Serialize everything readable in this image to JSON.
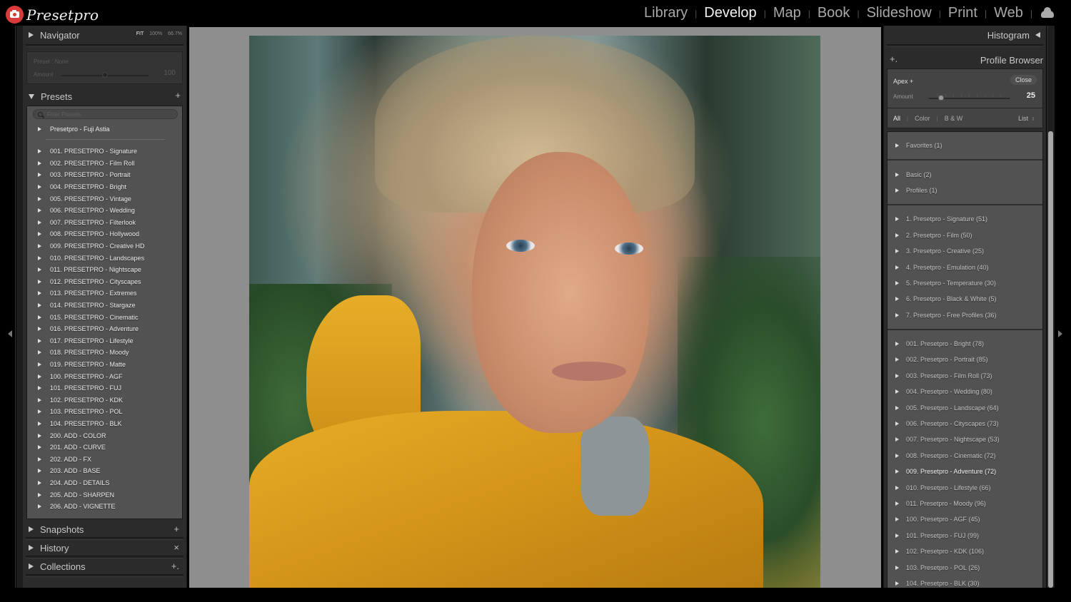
{
  "app": {
    "logo_text": "Presetpro",
    "modules": [
      {
        "label": "Library",
        "active": false
      },
      {
        "label": "Develop",
        "active": true
      },
      {
        "label": "Map",
        "active": false
      },
      {
        "label": "Book",
        "active": false
      },
      {
        "label": "Slideshow",
        "active": false
      },
      {
        "label": "Print",
        "active": false
      },
      {
        "label": "Web",
        "active": false
      }
    ],
    "cloud_icon": "cloud-icon"
  },
  "left_panel": {
    "navigator": {
      "title": "Navigator",
      "zoom_options": [
        "FIT",
        "100%",
        "66.7%"
      ]
    },
    "preset_amount": {
      "preset_label": "Preset : None",
      "amount_label": "Amount",
      "amount_value": "100",
      "slider_fraction": 0.5
    },
    "presets": {
      "title": "Presets",
      "add_icon": "+",
      "filter_placeholder": "Filter Presets",
      "top_item": "Presetpro - Fuji Astia",
      "items": [
        "001. PRESETPRO - Signature",
        "002. PRESETPRO - Film Roll",
        "003. PRESETPRO - Portrait",
        "004. PRESETPRO - Bright",
        "005. PRESETPRO - Vintage",
        "006. PRESETPRO - Wedding",
        "007. PRESETPRO - Filterlook",
        "008. PRESETPRO - Hollywood",
        "009. PRESETPRO - Creative HD",
        "010. PRESETPRO - Landscapes",
        "011. PRESETPRO - Nightscape",
        "012. PRESETPRO - Cityscapes",
        "013. PRESETPRO - Extremes",
        "014. PRESETPRO - Stargaze",
        "015. PRESETPRO - Cinematic",
        "016. PRESETPRO - Adventure",
        "017. PRESETPRO - Lifestyle",
        "018. PRESETPRO - Moody",
        "019. PRESETPRO - Matte",
        "100. PRESETPRO - AGF",
        "101. PRESETPRO - FUJ",
        "102. PRESETPRO - KDK",
        "103. PRESETPRO - POL",
        "104. PRESETPRO - BLK",
        "200. ADD - COLOR",
        "201. ADD - CURVE",
        "202. ADD - FX",
        "203. ADD - BASE",
        "204. ADD - DETAILS",
        "205. ADD - SHARPEN",
        "206. ADD - VIGNETTE"
      ]
    },
    "snapshots": {
      "title": "Snapshots",
      "action": "+"
    },
    "history": {
      "title": "History",
      "action": "×"
    },
    "collections": {
      "title": "Collections",
      "action": "+."
    }
  },
  "right_panel": {
    "histogram": {
      "title": "Histogram"
    },
    "profile_browser": {
      "title": "Profile Browser",
      "add_icon": "+.",
      "profile_name": "Apex +",
      "close_label": "Close",
      "amount_label": "Amount",
      "amount_value": "25",
      "slider_fraction": 0.15,
      "filters": [
        {
          "label": "All",
          "active": true
        },
        {
          "label": "Color",
          "active": false
        },
        {
          "label": "B & W",
          "active": false
        }
      ],
      "view_mode": "List",
      "groups": [
        [
          "Favorites (1)"
        ],
        [
          "Basic (2)",
          "Profiles (1)"
        ],
        [
          "1. Presetpro - Signature (51)",
          "2. Presetpro - Film (50)",
          "3. Presetpro - Creative (25)",
          "4. Presetpro - Emulation (40)",
          "5. Presetpro - Temperature (30)",
          "6. Presetpro - Black & White (5)",
          "7. Presetpro - Free Profiles (36)"
        ],
        [
          "001. Presetpro - Bright (78)",
          "002. Presetpro - Portrait (85)",
          "003. Presetpro - Film Roll (73)",
          "004. Presetpro - Wedding (80)",
          "005. Presetpro - Landscape (64)",
          "006. Presetpro - Cityscapes (73)",
          "007. Presetpro - Nightscape (53)",
          "008. Presetpro - Cinematic (72)",
          "009. Presetpro - Adventure (72)",
          "010. Presetpro - Lifestyle (66)",
          "011. Presetpro - Moody (96)",
          "100. Presetpro - AGF (45)",
          "101. Presetpro - FUJ (99)",
          "102. Presetpro - KDK (106)",
          "103. Presetpro - POL (26)",
          "104. Presetpro - BLK (30)"
        ]
      ],
      "highlighted_item": "009. Presetpro - Adventure (72)"
    }
  },
  "photo": {
    "description": "Portrait of a woman with wet blonde hair in a yellow rain jacket in a forest"
  }
}
